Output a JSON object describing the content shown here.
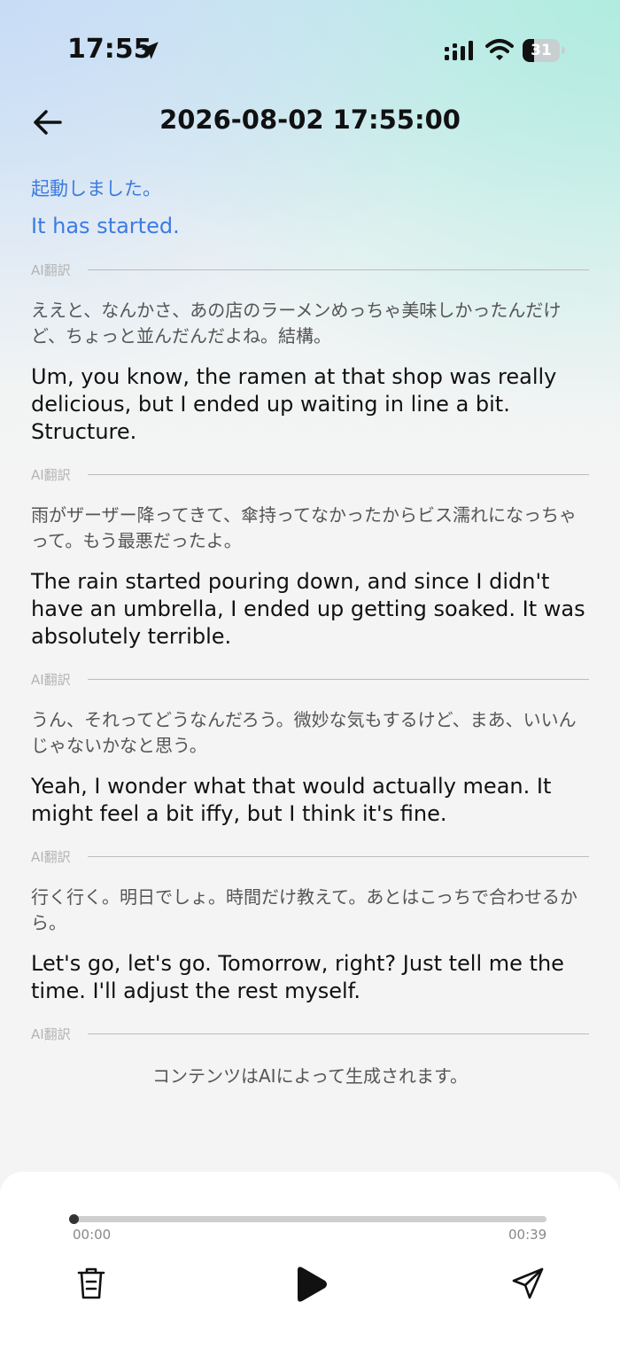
{
  "status_bar": {
    "time": "17:55",
    "battery_level": "31",
    "icons": [
      "location-arrow-icon",
      "signal-icon",
      "wifi-icon",
      "battery-icon"
    ]
  },
  "header": {
    "title": "2026-08-02 17:55:00",
    "back_icon": "arrow-left-icon"
  },
  "transcript": {
    "current": {
      "source": "起動しました。",
      "translation": "It has started."
    },
    "divider_label": "AI翻訳",
    "entries": [
      {
        "source": "ええと、なんかさ、あの店のラーメンめっちゃ美味しかったんだけど、ちょっと並んだんだよね。結構。",
        "translation": "Um, you know, the ramen at that shop was really delicious, but I ended up waiting in line a bit. Structure."
      },
      {
        "source": "雨がザーザー降ってきて、傘持ってなかったからビス濡れになっちゃって。もう最悪だったよ。",
        "translation": "The rain started pouring down, and since I didn't have an umbrella, I ended up getting soaked. It was absolutely terrible."
      },
      {
        "source": "うん、それってどうなんだろう。微妙な気もするけど、まあ、いいんじゃないかなと思う。",
        "translation": "Yeah, I wonder what that would actually mean. It might feel a bit iffy, but I think it's fine."
      },
      {
        "source": "行く行く。明日でしょ。時間だけ教えて。あとはこっちで合わせるから。",
        "translation": "Let's go, let's go. Tomorrow, right? Just tell me the time. I'll adjust the rest myself."
      }
    ],
    "footer_note": "コンテンツはAIによって生成されます。"
  },
  "player": {
    "current_time": "00:00",
    "total_time": "00:39",
    "progress": 0,
    "icons": [
      "trash-icon",
      "play-icon",
      "send-icon"
    ]
  },
  "colors": {
    "accent_blue": "#3d7be0",
    "background": "#f4f4f4"
  }
}
